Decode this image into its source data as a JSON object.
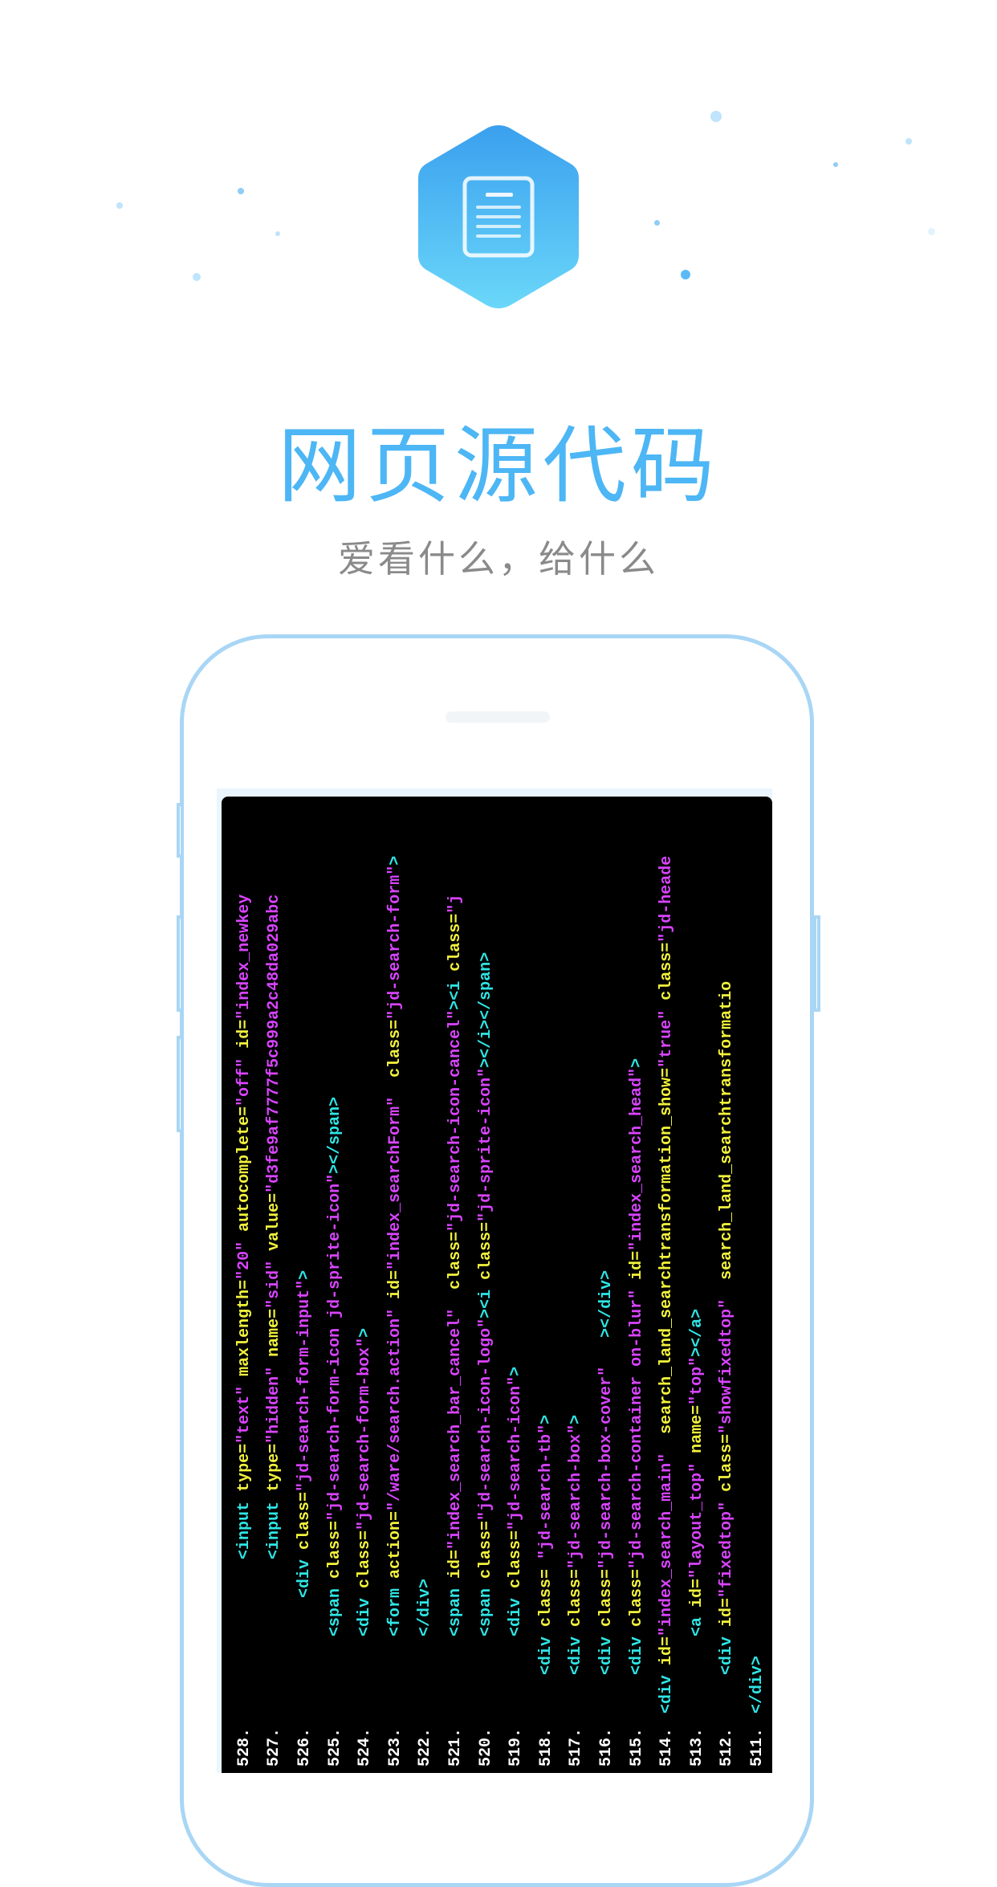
{
  "header": {
    "title": "网页源代码",
    "subtitle": "爱看什么，给什么",
    "app_icon": "document-icon"
  },
  "colors": {
    "accent": "#4db6f5",
    "icon_top": "#3aa0ee",
    "icon_bottom": "#6ad7f9",
    "code_bg": "#000000",
    "tag": "#2ee6e6",
    "attr": "#f2f23c",
    "value": "#d944ff"
  },
  "code_lines": [
    {
      "num": "511.",
      "indent": 0,
      "tokens": [
        {
          "t": "tag",
          "s": "</div>"
        }
      ]
    },
    {
      "num": "512.",
      "indent": 1,
      "tokens": [
        {
          "t": "tag",
          "s": "<div"
        },
        {
          "t": "attr",
          "s": " id="
        },
        {
          "t": "val",
          "s": "\"fixedtop\""
        },
        {
          "t": "attr",
          "s": " class="
        },
        {
          "t": "val",
          "s": "\"showfixedtop\""
        },
        {
          "t": "plain",
          "s": "  search_land_searchtransformatio"
        }
      ]
    },
    {
      "num": "513.",
      "indent": 2,
      "tokens": [
        {
          "t": "tag",
          "s": "<a"
        },
        {
          "t": "attr",
          "s": " id="
        },
        {
          "t": "val",
          "s": "\"layout_top\""
        },
        {
          "t": "attr",
          "s": " name="
        },
        {
          "t": "val",
          "s": "\"top\""
        },
        {
          "t": "tag",
          "s": "></a>"
        }
      ]
    },
    {
      "num": "514.",
      "indent": 0,
      "tokens": [
        {
          "t": "tag",
          "s": "<div"
        },
        {
          "t": "attr",
          "s": " id="
        },
        {
          "t": "val",
          "s": "\"index_search_main\""
        },
        {
          "t": "plain",
          "s": "  search_land_searchtransformation_show="
        },
        {
          "t": "val",
          "s": "\"true\""
        },
        {
          "t": "attr",
          "s": " class="
        },
        {
          "t": "val",
          "s": "\"jd-heade"
        }
      ]
    },
    {
      "num": "515.",
      "indent": 1,
      "tokens": [
        {
          "t": "tag",
          "s": "<div"
        },
        {
          "t": "attr",
          "s": " class="
        },
        {
          "t": "val",
          "s": "\"jd-search-container on-blur\""
        },
        {
          "t": "attr",
          "s": " id="
        },
        {
          "t": "val",
          "s": "\"index_search_head\""
        },
        {
          "t": "tag",
          "s": ">"
        }
      ]
    },
    {
      "num": "516.",
      "indent": 1,
      "tokens": [
        {
          "t": "tag",
          "s": "<div"
        },
        {
          "t": "attr",
          "s": " class="
        },
        {
          "t": "val",
          "s": "\"jd-search-box-cover\""
        },
        {
          "t": "tag",
          "s": "   ></div>"
        }
      ]
    },
    {
      "num": "517.",
      "indent": 1,
      "tokens": [
        {
          "t": "tag",
          "s": "<div"
        },
        {
          "t": "attr",
          "s": " class="
        },
        {
          "t": "val",
          "s": "\"jd-search-box\""
        },
        {
          "t": "tag",
          "s": ">"
        }
      ]
    },
    {
      "num": "518.",
      "indent": 1,
      "tokens": [
        {
          "t": "tag",
          "s": "<div"
        },
        {
          "t": "attr",
          "s": " class= "
        },
        {
          "t": "val",
          "s": "\"jd-search-tb\""
        },
        {
          "t": "tag",
          "s": ">"
        }
      ]
    },
    {
      "num": "519.",
      "indent": 2,
      "tokens": [
        {
          "t": "tag",
          "s": "<div"
        },
        {
          "t": "attr",
          "s": " class="
        },
        {
          "t": "val",
          "s": "\"jd-search-icon\""
        },
        {
          "t": "tag",
          "s": ">"
        }
      ]
    },
    {
      "num": "520.",
      "indent": 2,
      "tokens": [
        {
          "t": "tag",
          "s": "<span"
        },
        {
          "t": "attr",
          "s": " class="
        },
        {
          "t": "val",
          "s": "\"jd-search-icon-logo\""
        },
        {
          "t": "tag",
          "s": "><i"
        },
        {
          "t": "attr",
          "s": " class="
        },
        {
          "t": "val",
          "s": "\"jd-sprite-icon\""
        },
        {
          "t": "tag",
          "s": "></i></span>"
        }
      ]
    },
    {
      "num": "521.",
      "indent": 2,
      "tokens": [
        {
          "t": "tag",
          "s": "<span"
        },
        {
          "t": "attr",
          "s": " id="
        },
        {
          "t": "val",
          "s": "\"index_search_bar_cancel\""
        },
        {
          "t": "attr",
          "s": "  class="
        },
        {
          "t": "val",
          "s": "\"jd-search-icon-cancel\""
        },
        {
          "t": "tag",
          "s": "><i"
        },
        {
          "t": "attr",
          "s": " class="
        },
        {
          "t": "val",
          "s": "\"j"
        }
      ]
    },
    {
      "num": "522.",
      "indent": 2,
      "tokens": [
        {
          "t": "tag",
          "s": "</div>"
        }
      ]
    },
    {
      "num": "523.",
      "indent": 2,
      "tokens": [
        {
          "t": "tag",
          "s": "<form"
        },
        {
          "t": "attr",
          "s": " action="
        },
        {
          "t": "val",
          "s": "\"/ware/search.action\""
        },
        {
          "t": "attr",
          "s": " id="
        },
        {
          "t": "val",
          "s": "\"index_searchForm\""
        },
        {
          "t": "attr",
          "s": "  class="
        },
        {
          "t": "val",
          "s": "\"jd-search-form\""
        },
        {
          "t": "tag",
          "s": ">"
        }
      ]
    },
    {
      "num": "524.",
      "indent": 2,
      "tokens": [
        {
          "t": "tag",
          "s": "<div"
        },
        {
          "t": "attr",
          "s": " class="
        },
        {
          "t": "val",
          "s": "\"jd-search-form-box\""
        },
        {
          "t": "tag",
          "s": ">"
        }
      ]
    },
    {
      "num": "525.",
      "indent": 2,
      "tokens": [
        {
          "t": "tag",
          "s": "<span"
        },
        {
          "t": "attr",
          "s": " class="
        },
        {
          "t": "val",
          "s": "\"jd-search-form-icon jd-sprite-icon\""
        },
        {
          "t": "tag",
          "s": "></span>"
        }
      ]
    },
    {
      "num": "526.",
      "indent": 3,
      "tokens": [
        {
          "t": "tag",
          "s": "<div"
        },
        {
          "t": "attr",
          "s": " class="
        },
        {
          "t": "val",
          "s": "\"jd-search-form-input\""
        },
        {
          "t": "tag",
          "s": ">"
        }
      ]
    },
    {
      "num": "527.",
      "indent": 4,
      "tokens": [
        {
          "t": "tag",
          "s": "<input"
        },
        {
          "t": "attr",
          "s": " type="
        },
        {
          "t": "val",
          "s": "\"hidden\""
        },
        {
          "t": "attr",
          "s": " name="
        },
        {
          "t": "val",
          "s": "\"sid\""
        },
        {
          "t": "attr",
          "s": " value="
        },
        {
          "t": "val",
          "s": "\"d3fe9af7777f5c999a2c48da029abc"
        }
      ]
    },
    {
      "num": "528.",
      "indent": 4,
      "tokens": [
        {
          "t": "tag",
          "s": "<input"
        },
        {
          "t": "attr",
          "s": " type="
        },
        {
          "t": "val",
          "s": "\"text\""
        },
        {
          "t": "attr",
          "s": " maxlength="
        },
        {
          "t": "val",
          "s": "\"20\""
        },
        {
          "t": "attr",
          "s": " autocomplete="
        },
        {
          "t": "val",
          "s": "\"off\""
        },
        {
          "t": "attr",
          "s": " id="
        },
        {
          "t": "val",
          "s": "\"index_newkey"
        }
      ]
    }
  ]
}
